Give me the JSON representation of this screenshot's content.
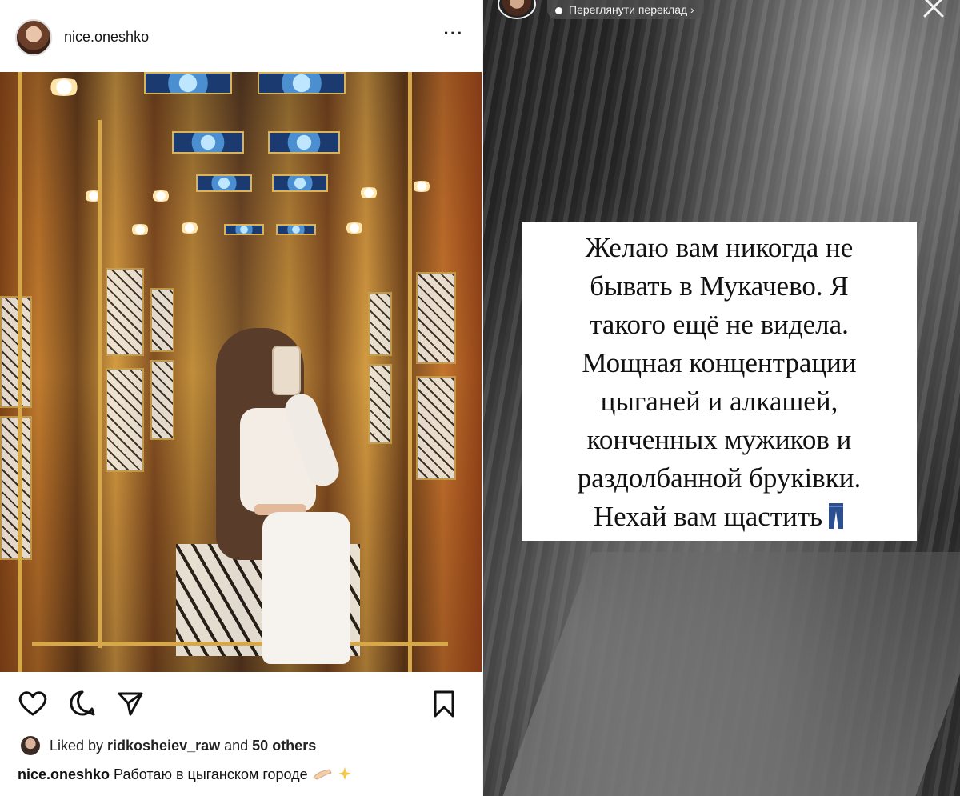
{
  "post": {
    "username": "nice.oneshko",
    "more_label": "···",
    "likes": {
      "prefix": "Liked by ",
      "liker": "ridkosheiev_raw",
      "middle": " and ",
      "count": "50 others"
    },
    "caption": {
      "user": "nice.oneshko",
      "text": "Работаю в цыганском городе"
    },
    "icons": [
      "heart-icon",
      "comment-icon",
      "share-icon",
      "bookmark-icon"
    ]
  },
  "story": {
    "translate_label": "Переглянути переклад ›",
    "text_lines": [
      "Желаю вам никогда не",
      "бывать в Мукачево. Я",
      "такого ещё не видела.",
      "Мощная концентрации",
      "цыганей и алкашей,",
      "конченных мужиков и",
      "раздолбанной бруківки.",
      "Нехай вам щастить"
    ]
  },
  "colors": {
    "post_bg": "#ffffff",
    "story_text_bg": "#ffffff",
    "jeans_blue": "#2b4f8f"
  }
}
